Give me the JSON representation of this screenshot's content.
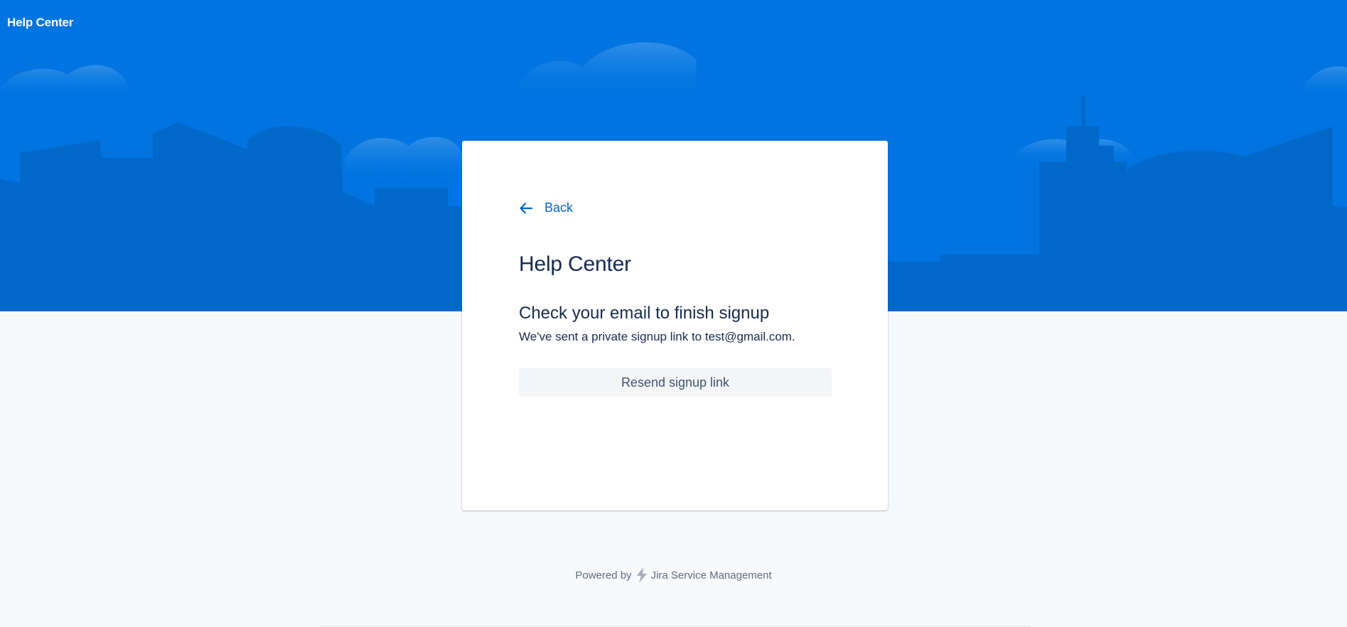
{
  "header": {
    "site_title": "Help Center"
  },
  "card": {
    "back_label": "Back",
    "portal_name": "Help Center",
    "heading": "Check your email to finish signup",
    "message": "We've sent a private signup link to test@gmail.com.",
    "resend_label": "Resend signup link"
  },
  "footer": {
    "powered_by": "Powered by",
    "product": "Jira Service Management"
  },
  "colors": {
    "hero_blue": "#0074e0",
    "skyline_dark": "#0068c9",
    "link_blue": "#0065ce",
    "text_dark": "#172b4d",
    "page_bg": "#f8f9fa"
  },
  "icons": {
    "back": "arrow-left-icon",
    "product": "jira-service-management-icon"
  }
}
